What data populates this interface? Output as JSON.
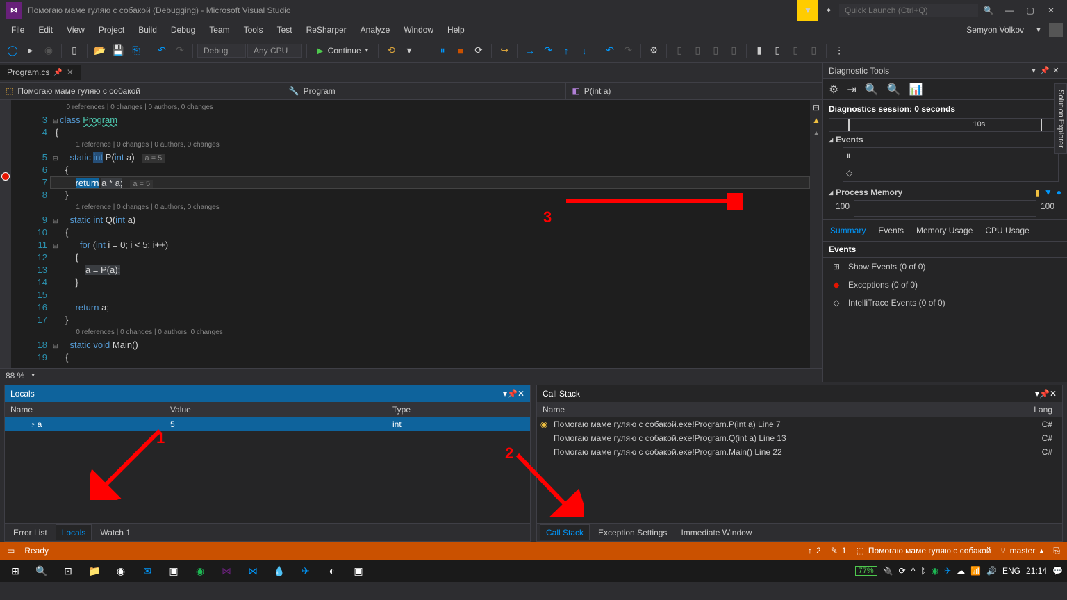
{
  "title": "Помогаю маме гуляю с собакой (Debugging) - Microsoft Visual Studio",
  "quick_launch_placeholder": "Quick Launch (Ctrl+Q)",
  "menu": [
    "File",
    "Edit",
    "View",
    "Project",
    "Build",
    "Debug",
    "Team",
    "Tools",
    "Test",
    "ReSharper",
    "Analyze",
    "Window",
    "Help"
  ],
  "user": "Semyon Volkov",
  "toolbar": {
    "config": "Debug",
    "platform": "Any CPU",
    "continue": "Continue"
  },
  "doc_tab": "Program.cs",
  "nav": {
    "ns": "Помогаю маме гуляю с собакой",
    "class": "Program",
    "method": "P(int a)"
  },
  "code": {
    "lens1": "0 references | 0 changes | 0 authors, 0 changes",
    "lens2": "1 reference | 0 changes | 0 authors, 0 changes",
    "lens3": "1 reference | 0 changes | 0 authors, 0 changes",
    "lens4": "0 references | 0 changes | 0 authors, 0 changes",
    "hint1": "a = 5",
    "hint2": "a = 5"
  },
  "zoom": "88 %",
  "diag": {
    "title": "Diagnostic Tools",
    "session": "Diagnostics session: 0 seconds",
    "timeline_label": "10s",
    "events_title": "Events",
    "memory_title": "Process Memory",
    "mem_left": "100",
    "mem_right": "100",
    "tabs": [
      "Summary",
      "Events",
      "Memory Usage",
      "CPU Usage"
    ],
    "events_section": "Events",
    "ev1": "Show Events (0 of 0)",
    "ev2": "Exceptions (0 of 0)",
    "ev3": "IntelliTrace Events (0 of 0)"
  },
  "side_tab": "Solution Explorer",
  "locals": {
    "title": "Locals",
    "cols": [
      "Name",
      "Value",
      "Type"
    ],
    "row": {
      "name": "a",
      "value": "5",
      "type": "int"
    }
  },
  "callstack": {
    "title": "Call Stack",
    "cols": [
      "Name",
      "Lang"
    ],
    "rows": [
      {
        "name": "Помогаю маме гуляю с собакой.exe!Program.P(int a) Line 7",
        "lang": "C#"
      },
      {
        "name": "Помогаю маме гуляю с собакой.exe!Program.Q(int a) Line 13",
        "lang": "C#"
      },
      {
        "name": "Помогаю маме гуляю с собакой.exe!Program.Main() Line 22",
        "lang": "C#"
      }
    ]
  },
  "bottom_tabs_left": [
    "Error List",
    "Locals",
    "Watch 1"
  ],
  "bottom_tabs_right": [
    "Call Stack",
    "Exception Settings",
    "Immediate Window"
  ],
  "status": {
    "ready": "Ready",
    "up": "2",
    "pencil": "1",
    "project": "Помогаю маме гуляю с собакой",
    "branch": "master"
  },
  "tray": {
    "battery": "77%",
    "lang": "ENG",
    "time": "21:14"
  },
  "annotations": {
    "a1": "1",
    "a2": "2",
    "a3": "3"
  }
}
